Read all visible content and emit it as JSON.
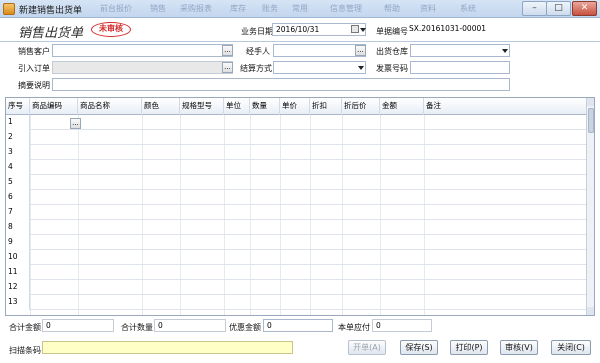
{
  "window": {
    "title": "新建销售出货单",
    "ghost_menu": [
      "前台报价",
      "销售",
      "采购报表",
      "库存",
      "账务",
      "常用",
      "信息管理",
      "帮助",
      "资料",
      "系统"
    ],
    "controls": {
      "minimize": "–",
      "maximize": "□",
      "close": "✕"
    }
  },
  "header": {
    "doc_title": "销售出货单",
    "stamp": "未审核",
    "date_label": "业务日期",
    "date_value": "2016/10/31",
    "docno_label": "单据编号",
    "docno_value": "SX.20161031-00001"
  },
  "form": {
    "customer_label": "销售客户",
    "customer_value": "",
    "handler_label": "经手人",
    "handler_value": "",
    "warehouse_label": "出货仓库",
    "warehouse_value": "",
    "order_label": "引入订单",
    "order_value": "",
    "settle_label": "结算方式",
    "settle_value": "",
    "invoice_label": "发票号码",
    "invoice_value": "",
    "remark_label": "摘要说明",
    "remark_value": ""
  },
  "grid": {
    "columns": [
      "序号",
      "商品编码",
      "商品名称",
      "颜色",
      "规格型号",
      "单位",
      "数量",
      "单价",
      "折扣",
      "折后价",
      "金额",
      "备注"
    ],
    "row_numbers": [
      "1",
      "2",
      "3",
      "4",
      "5",
      "6",
      "7",
      "8",
      "9",
      "10",
      "11",
      "12",
      "13"
    ],
    "row_button": "..."
  },
  "footer": {
    "total_amount_label": "合计金额",
    "total_amount_value": "0",
    "total_qty_label": "合计数量",
    "total_qty_value": "0",
    "discount_label": "优惠金额",
    "discount_value": "0",
    "payable_label": "本单应付",
    "payable_value": "0",
    "barcode_label": "扫描条码",
    "barcode_value": "",
    "buttons": {
      "new": "开单(A)",
      "save": "保存(S)",
      "print": "打印(P)",
      "audit": "审核(V)",
      "close": "关闭(C)"
    }
  }
}
